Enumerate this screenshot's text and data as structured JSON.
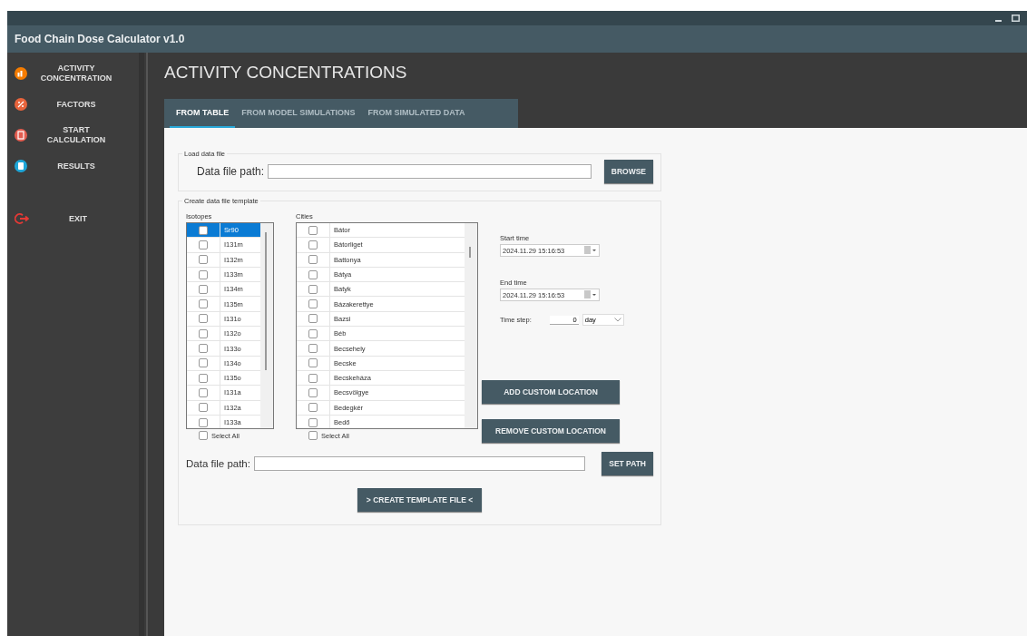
{
  "window": {
    "title": "Food Chain Dose Calculator v1.0"
  },
  "sidebar": {
    "items": [
      {
        "label": "ACTIVITY CONCENTRATION",
        "kind": "nav",
        "color": "#f57c00"
      },
      {
        "label": "FACTORS",
        "kind": "nav",
        "color": "#e8643c"
      },
      {
        "label": "START CALCULATION",
        "kind": "nav",
        "color": "#e35d50"
      },
      {
        "label": "RESULTS",
        "kind": "nav",
        "color": "#1ea6d8"
      },
      {
        "label": "EXIT",
        "kind": "exit",
        "color": "#e53935"
      }
    ]
  },
  "page_title": "ACTIVITY CONCENTRATIONS",
  "tabs": [
    {
      "label": "FROM TABLE",
      "selected": true
    },
    {
      "label": "FROM MODEL SIMULATIONS",
      "selected": false
    },
    {
      "label": "FROM SIMULATED DATA",
      "selected": false
    }
  ],
  "load_group": {
    "title": "Load data file",
    "path_label": "Data file path:",
    "button": "BROWSE"
  },
  "template_group": {
    "title": "Create data file template",
    "isotopes": {
      "label": "Isotopes",
      "select_all": {
        "label": "Select All",
        "checked": false
      },
      "items": [
        {
          "name": "Sr90",
          "checked": false,
          "selected": true
        },
        {
          "name": "I131m",
          "checked": false,
          "selected": false
        },
        {
          "name": "I132m",
          "checked": false,
          "selected": false
        },
        {
          "name": "I133m",
          "checked": false,
          "selected": false
        },
        {
          "name": "I134m",
          "checked": false,
          "selected": false
        },
        {
          "name": "I135m",
          "checked": false,
          "selected": false
        },
        {
          "name": "I131o",
          "checked": false,
          "selected": false
        },
        {
          "name": "I132o",
          "checked": false,
          "selected": false
        },
        {
          "name": "I133o",
          "checked": false,
          "selected": false
        },
        {
          "name": "I134o",
          "checked": false,
          "selected": false
        },
        {
          "name": "I135o",
          "checked": false,
          "selected": false
        },
        {
          "name": "I131a",
          "checked": false,
          "selected": false
        },
        {
          "name": "I132a",
          "checked": false,
          "selected": false
        },
        {
          "name": "I133a",
          "checked": false,
          "selected": false
        }
      ]
    },
    "cities": {
      "label": "Cities",
      "select_all": {
        "label": "Select All",
        "checked": false
      },
      "items": [
        {
          "name": "Bátor",
          "checked": false,
          "selected": false
        },
        {
          "name": "Bátorliget",
          "checked": false,
          "selected": false
        },
        {
          "name": "Battonya",
          "checked": false,
          "selected": false
        },
        {
          "name": "Bátya",
          "checked": false,
          "selected": false
        },
        {
          "name": "Batyk",
          "checked": false,
          "selected": false
        },
        {
          "name": "Bázakerettye",
          "checked": false,
          "selected": false
        },
        {
          "name": "Bazsi",
          "checked": false,
          "selected": false
        },
        {
          "name": "Béb",
          "checked": false,
          "selected": false
        },
        {
          "name": "Becsehely",
          "checked": false,
          "selected": false
        },
        {
          "name": "Becske",
          "checked": false,
          "selected": false
        },
        {
          "name": "Becskeháza",
          "checked": false,
          "selected": false
        },
        {
          "name": "Becsvölgye",
          "checked": false,
          "selected": false
        },
        {
          "name": "Bedegkér",
          "checked": false,
          "selected": false
        },
        {
          "name": "Bedő",
          "checked": false,
          "selected": false
        }
      ]
    },
    "start_time": {
      "label": "Start time",
      "value": "2024.11.29 15:16:53"
    },
    "end_time": {
      "label": "End time",
      "value": "2024.11.29 15:16:53"
    },
    "time_step": {
      "label": "Time step:",
      "value": "0",
      "unit": "day"
    },
    "add_button": "ADD CUSTOM LOCATION",
    "remove_button": "REMOVE CUSTOM LOCATION",
    "path_label": "Data file path:",
    "path_button": "SET PATH",
    "create_button": "> CREATE TEMPLATE FILE <"
  }
}
